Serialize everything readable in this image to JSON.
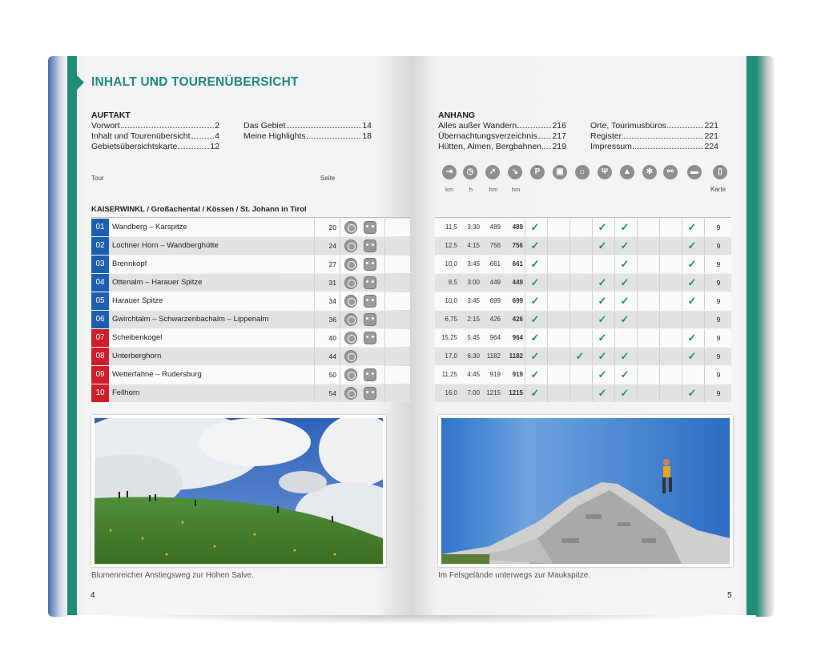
{
  "left_page": {
    "title": "INHALT UND TOURENÜBERSICHT",
    "auftakt": {
      "heading": "AUFTAKT",
      "col1": [
        {
          "label": "Vorwort",
          "page": "2"
        },
        {
          "label": "Inhalt und Tourenübersicht",
          "page": "4"
        },
        {
          "label": "Gebietsübersichtskarte",
          "page": "12"
        }
      ],
      "col2": [
        {
          "label": "Das Gebiet",
          "page": "14"
        },
        {
          "label": "Meine Highlights",
          "page": "18"
        }
      ]
    },
    "col_tour": "Tour",
    "col_seite": "Seite",
    "section": "KAISERWINKL / Großachental / Kössen / St. Johann in Tirol",
    "caption": "Blumenreicher Anstiegsweg zur Hohen Salve.",
    "page_number": "4"
  },
  "right_page": {
    "anhang": {
      "heading": "ANHANG",
      "col1": [
        {
          "label": "Alles außer Wandern",
          "page": "216"
        },
        {
          "label": "Übernachtungsverzeichnis",
          "page": "217"
        },
        {
          "label": "Hütten, Almen, Bergbahnen",
          "page": "219"
        }
      ],
      "col2": [
        {
          "label": "Orte, Tourimusbüros",
          "page": "221"
        },
        {
          "label": "Register",
          "page": "221"
        },
        {
          "label": "Impressum",
          "page": "224"
        }
      ]
    },
    "units": [
      "km",
      "h",
      "hm",
      "hm"
    ],
    "col_karte": "Karte",
    "header_icons": [
      "signpost-icon",
      "clock-icon",
      "ascent-icon",
      "descent-icon",
      "parking-icon",
      "bus-icon",
      "cable-car-icon",
      "restaurant-icon",
      "summit-icon",
      "winter-icon",
      "bike-icon",
      "bed-icon",
      "phone-icon"
    ],
    "caption": "Im Felsgelände unterwegs zur Maukspitze.",
    "page_number": "5"
  },
  "colors": {
    "accent": "#1f8b78",
    "blue": "#1b5fb0",
    "red": "#cf1d2b"
  },
  "tours": [
    {
      "no": "01",
      "name": "Wandberg – Karspitze",
      "page": "20",
      "color": "blue",
      "bear": true,
      "km": "11,5",
      "h": "3:30",
      "up": "489",
      "down": "489",
      "ticks": [
        1,
        0,
        0,
        1,
        1,
        0,
        0,
        1,
        1,
        0
      ],
      "karte": "9"
    },
    {
      "no": "02",
      "name": "Lochner Horn – Wandberghütte",
      "page": "24",
      "color": "blue",
      "bear": true,
      "km": "12,5",
      "h": "4:15",
      "up": "756",
      "down": "756",
      "ticks": [
        1,
        0,
        0,
        1,
        1,
        0,
        0,
        0,
        1,
        0
      ],
      "karte": "9"
    },
    {
      "no": "03",
      "name": "Brennkopf",
      "page": "27",
      "color": "blue",
      "bear": true,
      "km": "10,0",
      "h": "3:45",
      "up": "661",
      "down": "661",
      "ticks": [
        1,
        0,
        0,
        0,
        1,
        0,
        0,
        0,
        1,
        0
      ],
      "karte": "9"
    },
    {
      "no": "04",
      "name": "Ottenalm – Harauer Spitze",
      "page": "31",
      "color": "blue",
      "bear": true,
      "km": "8,5",
      "h": "3:00",
      "up": "449",
      "down": "449",
      "ticks": [
        1,
        0,
        0,
        1,
        1,
        0,
        0,
        0,
        1,
        0
      ],
      "karte": "9"
    },
    {
      "no": "05",
      "name": "Harauer Spitze",
      "page": "34",
      "color": "blue",
      "bear": true,
      "km": "10,0",
      "h": "3:45",
      "up": "699",
      "down": "699",
      "ticks": [
        1,
        0,
        0,
        1,
        1,
        0,
        0,
        0,
        1,
        0
      ],
      "karte": "9"
    },
    {
      "no": "06",
      "name": "Gwirchtalm – Schwarzenbachalm – Lippenalm",
      "page": "36",
      "color": "blue",
      "bear": true,
      "km": "6,75",
      "h": "2:15",
      "up": "426",
      "down": "426",
      "ticks": [
        1,
        0,
        0,
        1,
        1,
        0,
        0,
        0,
        0,
        0
      ],
      "karte": "9"
    },
    {
      "no": "07",
      "name": "Scheibenkogel",
      "page": "40",
      "color": "red",
      "bear": true,
      "km": "15,25",
      "h": "5:45",
      "up": "964",
      "down": "964",
      "ticks": [
        1,
        0,
        0,
        1,
        0,
        0,
        0,
        0,
        1,
        0
      ],
      "karte": "9"
    },
    {
      "no": "08",
      "name": "Unterberghorn",
      "page": "44",
      "color": "red",
      "bear": false,
      "km": "17,0",
      "h": "6:30",
      "up": "1182",
      "down": "1182",
      "ticks": [
        1,
        0,
        1,
        1,
        1,
        0,
        0,
        0,
        1,
        0
      ],
      "karte": "9"
    },
    {
      "no": "09",
      "name": "Wetterfahne – Rudersburg",
      "page": "50",
      "color": "red",
      "bear": true,
      "km": "11,25",
      "h": "4:45",
      "up": "919",
      "down": "919",
      "ticks": [
        1,
        0,
        0,
        1,
        1,
        0,
        0,
        0,
        0,
        0
      ],
      "karte": "9"
    },
    {
      "no": "10",
      "name": "Fellhorn",
      "page": "54",
      "color": "red",
      "bear": true,
      "km": "16,0",
      "h": "7:00",
      "up": "1215",
      "down": "1215",
      "ticks": [
        1,
        0,
        0,
        1,
        1,
        0,
        0,
        0,
        1,
        0
      ],
      "karte": "9"
    }
  ]
}
